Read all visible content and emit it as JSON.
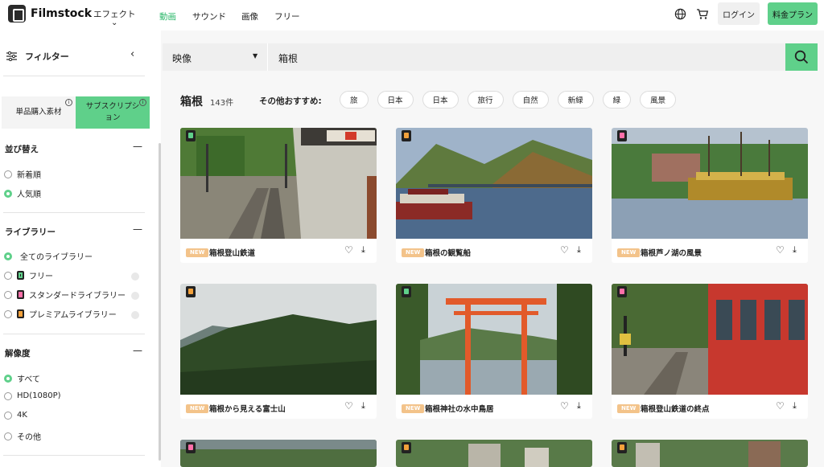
{
  "header": {
    "logo_text": "Filmstock",
    "nav": {
      "effect": "エフェクト",
      "video": "動画",
      "sound": "サウンド",
      "image": "画像",
      "free": "フリー"
    },
    "login": "ログイン",
    "plan": "料金プラン"
  },
  "sidebar": {
    "filter_label": "フィルター",
    "tabs": {
      "single": "単品購入素材",
      "subscription": "サブスクリプション"
    },
    "sort": {
      "title": "並び替え",
      "options": [
        "新着順",
        "人気順"
      ]
    },
    "library": {
      "title": "ライブラリー",
      "options": [
        "全てのライブラリー",
        "フリー",
        "スタンダードライブラリー",
        "プレミアムライブラリー"
      ]
    },
    "resolution": {
      "title": "解像度",
      "options": [
        "すべて",
        "HD(1080P)",
        "4K",
        "その他"
      ]
    }
  },
  "search": {
    "category": "映像",
    "query": "箱根"
  },
  "results": {
    "title": "箱根",
    "count": "143件",
    "rec_label": "その他おすすめ:",
    "tags": [
      "旅",
      "日本",
      "日本",
      "旅行",
      "自然",
      "新緑",
      "緑",
      "風景"
    ]
  },
  "cards": [
    {
      "title": "箱根登山鉄道",
      "new": "NEW",
      "library": "free"
    },
    {
      "title": "箱根の観覧船",
      "new": "NEW",
      "library": "premium"
    },
    {
      "title": "箱根芦ノ湖の風景",
      "new": "NEW",
      "library": "standard"
    },
    {
      "title": "箱根から見える富士山",
      "new": "NEW",
      "library": "premium"
    },
    {
      "title": "箱根神社の水中鳥居",
      "new": "NEW",
      "library": "free"
    },
    {
      "title": "箱根登山鉄道の終点",
      "new": "NEW",
      "library": "standard"
    }
  ],
  "colors": {
    "accent": "#5fd08a",
    "new_badge": "#f3c38a"
  }
}
